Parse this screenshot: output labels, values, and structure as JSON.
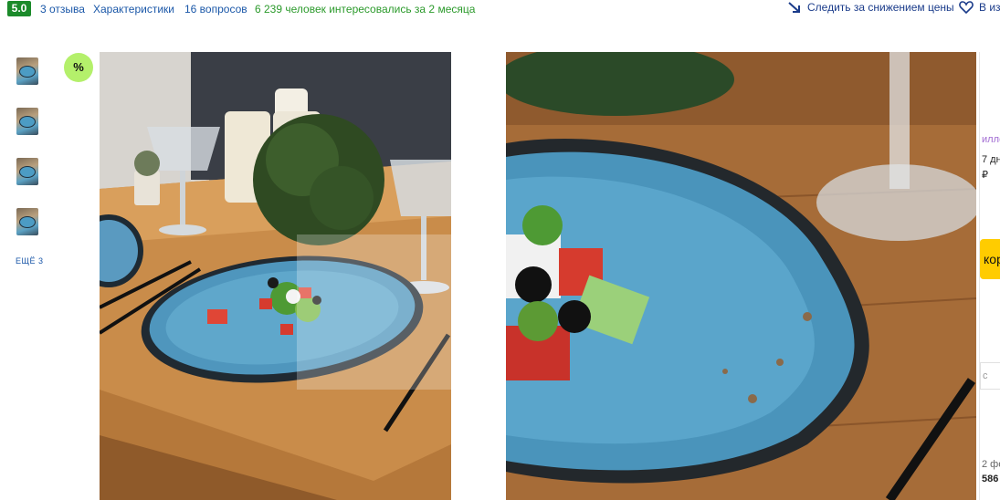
{
  "topbar": {
    "rating": "5.0",
    "reviews": "3 отзыва",
    "specs": "Характеристики",
    "questions": "16 вопросов",
    "interest": "6 239 человек интересовались за 2 месяца",
    "watch_price": "Следить за снижением цены",
    "favorites": "В из"
  },
  "gallery": {
    "more": "ЕЩЁ 3",
    "badge": "%"
  },
  "right_column": {
    "line1": "илло",
    "line2": "7 дн",
    "line3": "₽",
    "cart_button": "кор",
    "box_text": "с",
    "date": "2 фе",
    "price": "586"
  },
  "colors": {
    "rating_bg": "#1b8a2a",
    "link": "#1a57a8",
    "interest": "#2b9a2b",
    "badge": "#b4f06b",
    "cart": "#ffcc00"
  }
}
